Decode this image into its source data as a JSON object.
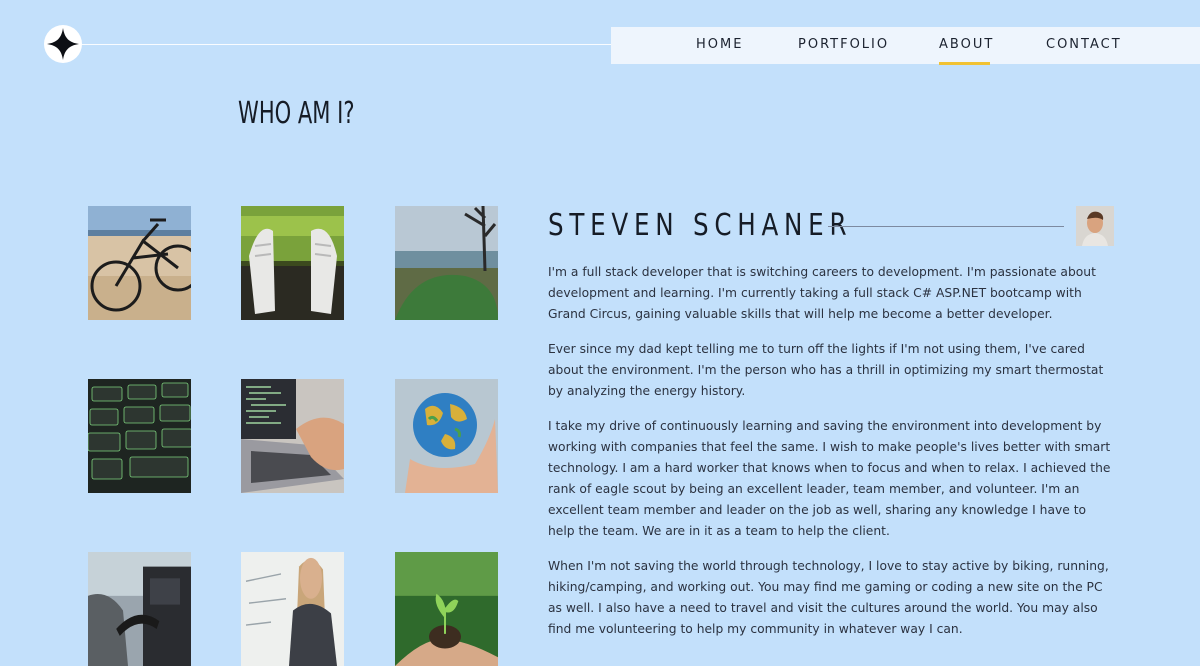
{
  "header": {
    "logo_icon": "four-point-star-icon",
    "nav": [
      {
        "label": "HOME",
        "active": false
      },
      {
        "label": "PORTFOLIO",
        "active": false
      },
      {
        "label": "ABOUT",
        "active": true
      },
      {
        "label": "CONTACT",
        "active": false
      }
    ],
    "active_underline_color": "#f1c232"
  },
  "page_title": "WHO AM I?",
  "gallery": [
    {
      "subject": "bicycle-on-beach"
    },
    {
      "subject": "sneakers-on-grass"
    },
    {
      "subject": "tent-by-lake"
    },
    {
      "subject": "backlit-keyboard"
    },
    {
      "subject": "laptop-coding"
    },
    {
      "subject": "globe-in-hand"
    },
    {
      "subject": "ev-charger"
    },
    {
      "subject": "woman-at-whiteboard"
    },
    {
      "subject": "seedling-in-hands"
    }
  ],
  "profile": {
    "name": "STEVEN SCHANER",
    "avatar_icon": "profile-photo",
    "bio": [
      "I'm a full stack developer that is switching careers to development. I'm passionate about development and learning. I'm currently taking a full stack C# ASP.NET bootcamp with Grand Circus, gaining valuable skills that will help me become a better developer.",
      "Ever since my dad kept telling me to turn off the lights if I'm not using them, I've cared about the environment. I'm the person who has a thrill in optimizing my smart thermostat by analyzing the energy history.",
      "I take my drive of continuously learning and saving the environment into development by working with companies that feel the same. I wish to make people's lives better with smart technology. I am a hard worker that knows when to focus and when to relax. I achieved the rank of eagle scout by being an excellent leader, team member, and volunteer. I'm an excellent team member and leader on the job as well, sharing any knowledge I have to help the team. We are in it as a team to help the client.",
      "When I'm not saving the world through technology, I love to stay active by biking, running, hiking/camping, and working out. You may find me gaming or coding a new site on the PC as well. I also have a need to travel and visit the cultures around the world. You may also find me volunteering to help my community in whatever way I can."
    ]
  },
  "colors": {
    "background": "#c3e0fb",
    "nav_background": "#eef5fd",
    "text": "#1c2330"
  }
}
